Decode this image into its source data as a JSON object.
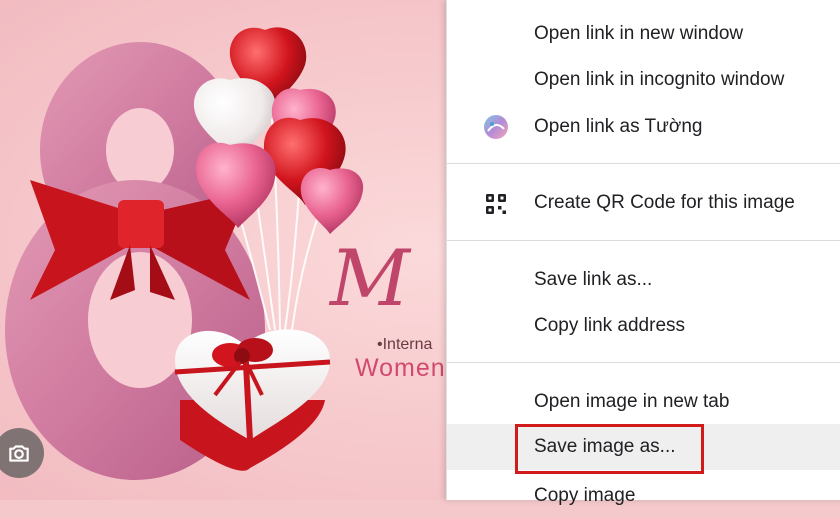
{
  "poster": {
    "title_fragment": "M",
    "subtitle_fragment": "•Interna",
    "women_fragment": "Women"
  },
  "lens_button": {
    "icon": "camera-icon"
  },
  "context_menu": {
    "items": [
      {
        "label": "Open link in new window"
      },
      {
        "label": "Open link in incognito window"
      },
      {
        "label": "Open link as Tường",
        "icon": "profile-avatar-icon"
      },
      {
        "label": "Create QR Code for this image",
        "icon": "qr-code-icon"
      },
      {
        "label": "Save link as..."
      },
      {
        "label": "Copy link address"
      },
      {
        "label": "Open image in new tab"
      },
      {
        "label": "Save image as...",
        "highlighted": true
      },
      {
        "label": "Copy image"
      }
    ]
  },
  "colors": {
    "highlight_box": "#d11a1a",
    "menu_background": "#ffffff",
    "poster_background": "#f5c9cc"
  }
}
